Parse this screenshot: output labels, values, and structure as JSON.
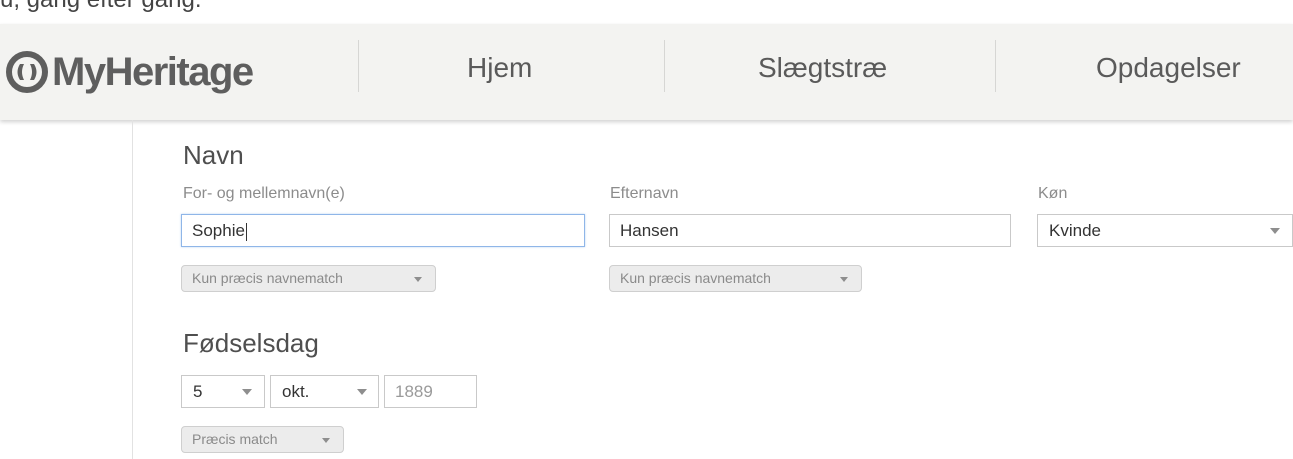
{
  "top_strip": {
    "text": "u, gang efter gang."
  },
  "nav": {
    "logo_text": "MyHeritage",
    "items": [
      {
        "label": "Hjem"
      },
      {
        "label": "Slægtstræ"
      },
      {
        "label": "Opdagelser"
      }
    ]
  },
  "name_section": {
    "title": "Navn",
    "first": {
      "label": "For- og mellemnavn(e)",
      "value": "Sophie",
      "match": "Kun præcis navnematch"
    },
    "last": {
      "label": "Efternavn",
      "value": "Hansen",
      "match": "Kun præcis navnematch"
    },
    "gender": {
      "label": "Køn",
      "value": "Kvinde"
    }
  },
  "birth_section": {
    "title": "Fødselsdag",
    "day": "5",
    "month": "okt.",
    "year": "1889",
    "match": "Præcis match"
  },
  "colors": {
    "navbar_bg": "#f3f3f1",
    "focus_border": "#8fb6e8",
    "text_dark": "#4f4f4f",
    "label_gray": "#8c8c8c"
  }
}
